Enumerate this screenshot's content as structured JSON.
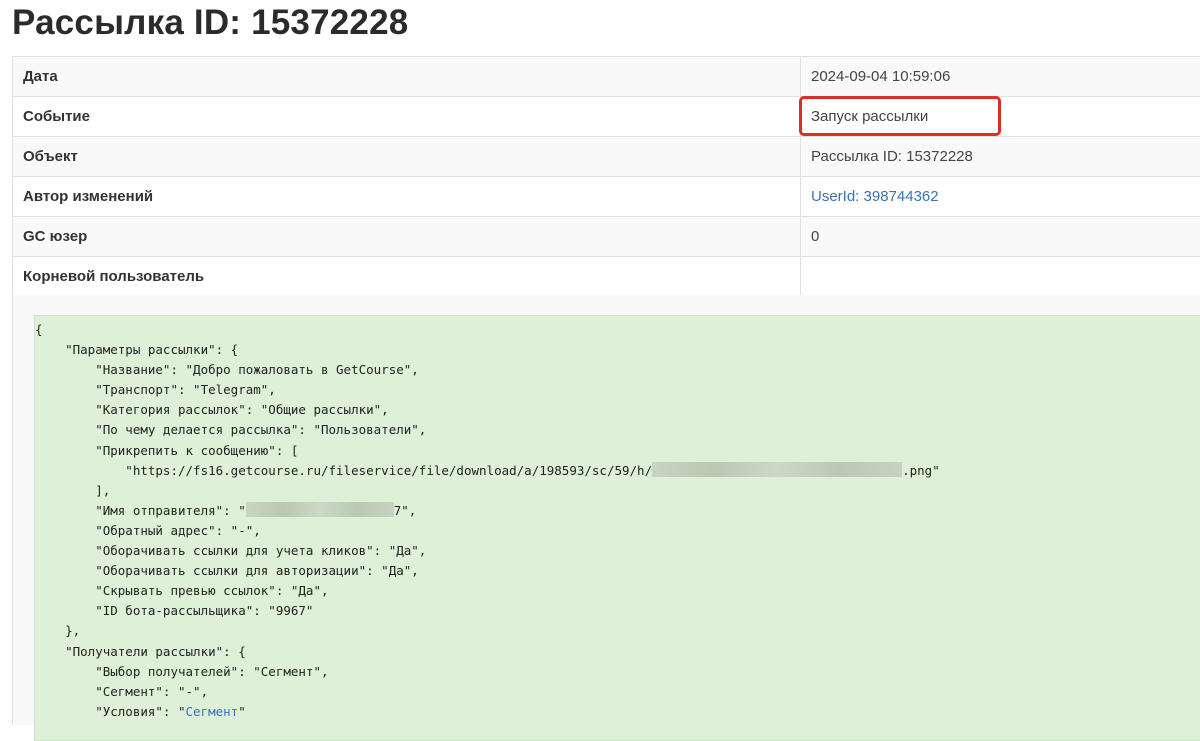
{
  "title": "Рассылка ID: 15372228",
  "rows": [
    {
      "label": "Дата",
      "value": "2024-09-04 10:59:06"
    },
    {
      "label": "Событие",
      "value": "Запуск рассылки"
    },
    {
      "label": "Объект",
      "value": "Рассылка ID: 15372228"
    },
    {
      "label": "Автор изменений",
      "value": "UserId: 398744362"
    },
    {
      "label": "GC юзер",
      "value": "0"
    },
    {
      "label": "Корневой пользователь",
      "value": ""
    }
  ],
  "json": {
    "open": "{",
    "params_key": "    \"Параметры рассылки\": {",
    "name": "        \"Название\": \"Добро пожаловать в GetCourse\",",
    "transport": "        \"Транспорт\": \"Telegram\",",
    "category": "        \"Категория рассылок\": \"Общие рассылки\",",
    "based_on": "        \"По чему делается рассылка\": \"Пользователи\",",
    "attach_key": "        \"Прикрепить к сообщению\": [",
    "attach_url_prefix": "            \"https://fs16.getcourse.ru/fileservice/file/download/a/198593/sc/59/h/",
    "attach_url_suffix": ".png\"",
    "attach_close": "        ],",
    "sender_prefix": "        \"Имя отправителя\": \"",
    "sender_suffix": "7\",",
    "reply": "        \"Обратный адрес\": \"-\",",
    "wrap_clicks": "        \"Оборачивать ссылки для учета кликов\": \"Да\",",
    "wrap_auth": "        \"Оборачивать ссылки для авторизации\": \"Да\",",
    "hide_preview": "        \"Скрывать превью ссылок\": \"Да\",",
    "bot_id": "        \"ID бота-рассыльщика\": \"9967\"",
    "params_close": "    },",
    "recipients_key": "    \"Получатели рассылки\": {",
    "choice": "        \"Выбор получателей\": \"Сегмент\",",
    "segment": "        \"Сегмент\": \"-\",",
    "conditions_prefix": "        \"Условия\": \"",
    "conditions_link": "Сегмент",
    "conditions_suffix": "\""
  }
}
